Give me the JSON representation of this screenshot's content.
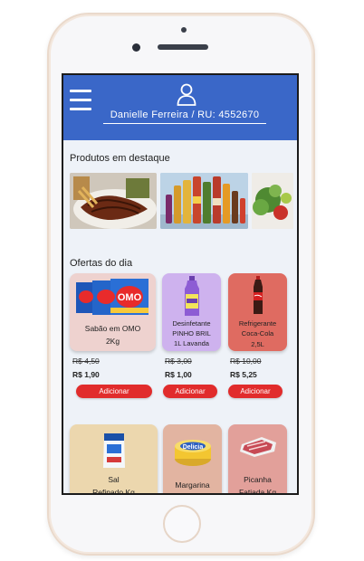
{
  "header": {
    "user_label": "Danielle Ferreira / RU: 4552670"
  },
  "featured": {
    "title": "Produtos em destaque"
  },
  "offers": {
    "title": "Ofertas do dia",
    "add_label": "Adicionar",
    "items": [
      {
        "name_line1": "Sabão em OMO",
        "name_line2": "2Kg",
        "old_price": "R$ 4,50",
        "new_price": "R$ 1,90",
        "card_color": "#eed2cf"
      },
      {
        "name_line1": "Desinfetante",
        "name_line2": "PINHO BRIL",
        "name_line3": "1L Lavanda",
        "old_price": "R$ 3,00",
        "new_price": "R$ 1,00",
        "card_color": "#ceb2ee"
      },
      {
        "name_line1": "Refrigerante",
        "name_line2": "Coca-Cola",
        "name_line3": "2,5L",
        "old_price": "R$ 10,00",
        "new_price": "R$ 5,25",
        "card_color": "#df6b61"
      },
      {
        "name_line1": "Sal",
        "name_line2": "Refinado Kg",
        "card_color": "#ecd7ae"
      },
      {
        "name_line1": "Margarina",
        "card_color": "#e2b4a1"
      },
      {
        "name_line1": "Picanha",
        "name_line2": "Fatiada Kg",
        "card_color": "#e2a09a"
      }
    ]
  }
}
